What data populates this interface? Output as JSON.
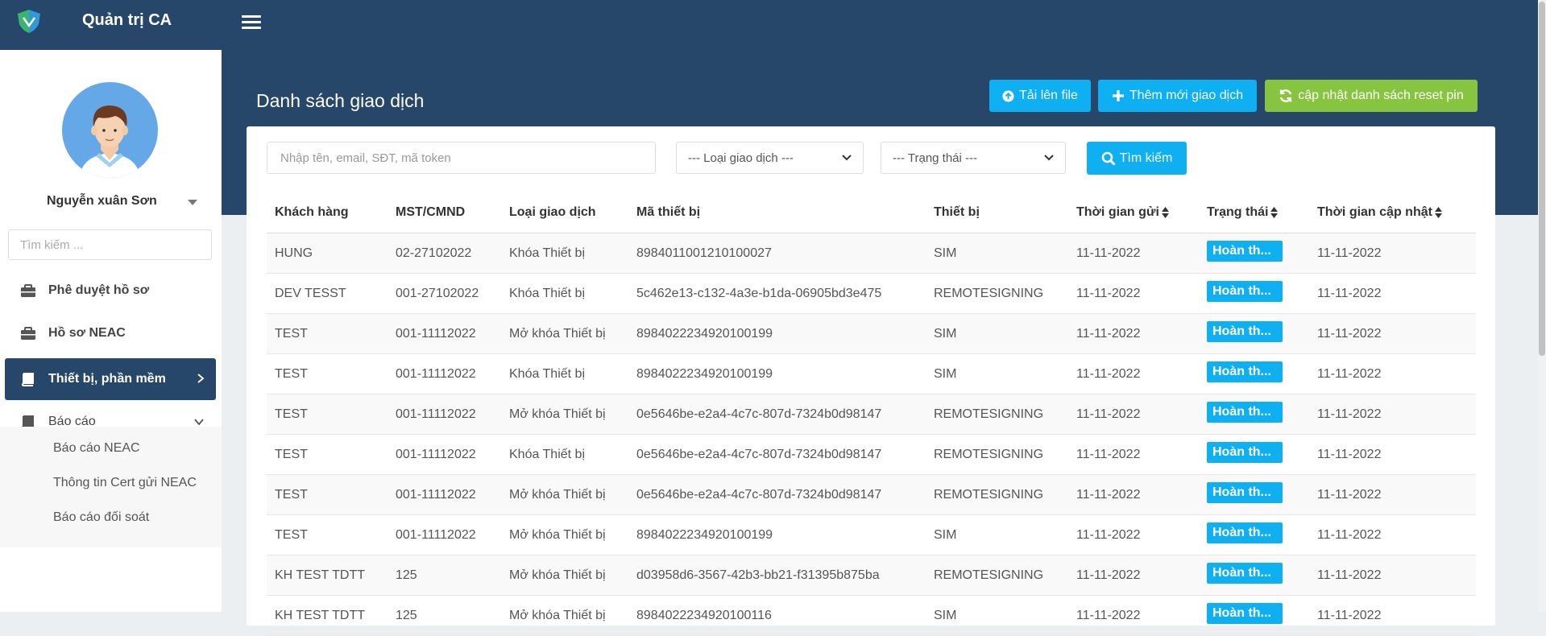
{
  "app": {
    "title": "Quản trị CA",
    "logo_icon": "shield-logo-icon"
  },
  "colors": {
    "primary": "#27476a",
    "accent": "#0fb0f2",
    "success": "#87c540",
    "background": "#ebeff2"
  },
  "user": {
    "name": "Nguyễn xuân Sơn"
  },
  "sidebar": {
    "search_placeholder": "Tìm kiếm ...",
    "items": [
      {
        "label": "Phê duyệt hồ sơ",
        "icon": "briefcase-icon"
      },
      {
        "label": "Hồ sơ NEAC",
        "icon": "briefcase-icon"
      },
      {
        "label": "Thiết bị, phần mềm",
        "icon": "book-icon",
        "active": true
      },
      {
        "label": "Báo cáo",
        "icon": "book-icon",
        "expanded": true
      }
    ],
    "report_subitems": [
      "Báo cáo NEAC",
      "Thông tin Cert gửi NEAC",
      "Báo cáo đối soát"
    ]
  },
  "page": {
    "title": "Danh sách giao dịch"
  },
  "toolbar": {
    "upload_label": "Tải lên file",
    "add_label": "Thêm mới giao dịch",
    "refresh_label": "cập nhật danh sách reset pin"
  },
  "filters": {
    "search_placeholder": "Nhập tên, email, SĐT, mã token",
    "type_select": "--- Loại giao dịch ---",
    "status_select": "--- Trạng thái ---",
    "search_button": "Tìm kiếm"
  },
  "table": {
    "columns": [
      "Khách hàng",
      "MST/CMND",
      "Loại giao dịch",
      "Mã thiết bị",
      "Thiết bị",
      "Thời gian gửi",
      "Trạng thái",
      "Thời gian cập nhật"
    ],
    "sortable": [
      false,
      false,
      false,
      false,
      false,
      true,
      true,
      true
    ],
    "rows": [
      [
        "HUNG",
        "02-27102022",
        "Khóa Thiết bị",
        "8984011001210100027",
        "SIM",
        "11-11-2022",
        "Hoàn th...",
        "11-11-2022"
      ],
      [
        "DEV TESST",
        "001-27102022",
        "Khóa Thiết bị",
        "5c462e13-c132-4a3e-b1da-06905bd3e475",
        "REMOTESIGNING",
        "11-11-2022",
        "Hoàn th...",
        "11-11-2022"
      ],
      [
        "TEST",
        "001-11112022",
        "Mở khóa Thiết bị",
        "8984022234920100199",
        "SIM",
        "11-11-2022",
        "Hoàn th...",
        "11-11-2022"
      ],
      [
        "TEST",
        "001-11112022",
        "Khóa Thiết bị",
        "8984022234920100199",
        "SIM",
        "11-11-2022",
        "Hoàn th...",
        "11-11-2022"
      ],
      [
        "TEST",
        "001-11112022",
        "Mở khóa Thiết bị",
        "0e5646be-e2a4-4c7c-807d-7324b0d98147",
        "REMOTESIGNING",
        "11-11-2022",
        "Hoàn th...",
        "11-11-2022"
      ],
      [
        "TEST",
        "001-11112022",
        "Khóa Thiết bị",
        "0e5646be-e2a4-4c7c-807d-7324b0d98147",
        "REMOTESIGNING",
        "11-11-2022",
        "Hoàn th...",
        "11-11-2022"
      ],
      [
        "TEST",
        "001-11112022",
        "Mở khóa Thiết bị",
        "0e5646be-e2a4-4c7c-807d-7324b0d98147",
        "REMOTESIGNING",
        "11-11-2022",
        "Hoàn th...",
        "11-11-2022"
      ],
      [
        "TEST",
        "001-11112022",
        "Mở khóa Thiết bị",
        "8984022234920100199",
        "SIM",
        "11-11-2022",
        "Hoàn th...",
        "11-11-2022"
      ],
      [
        "KH TEST TDTT",
        "125",
        "Mở khóa Thiết bị",
        "d03958d6-3567-42b3-bb21-f31395b875ba",
        "REMOTESIGNING",
        "11-11-2022",
        "Hoàn th...",
        "11-11-2022"
      ],
      [
        "KH TEST TDTT",
        "125",
        "Mở khóa Thiết bị",
        "8984022234920100116",
        "SIM",
        "11-11-2022",
        "Hoàn th...",
        "11-11-2022"
      ]
    ]
  }
}
